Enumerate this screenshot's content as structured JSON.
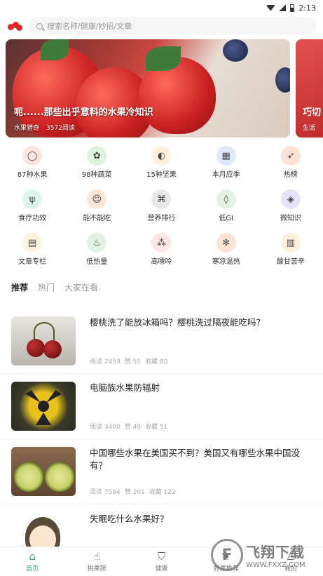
{
  "status": {
    "time": "2:13"
  },
  "search": {
    "placeholder": "搜索名称/健康/妙招/文章"
  },
  "banners": [
    {
      "title": "呃......那些出乎意料的水果冷知识",
      "tag": "水果猎奇",
      "reads": "3572阅读"
    },
    {
      "title": "巧切",
      "tag": "生活"
    }
  ],
  "categories": [
    {
      "label": "87种水果",
      "icon": "apple-icon",
      "color": "#fde5e2"
    },
    {
      "label": "98种蔬菜",
      "icon": "broccoli-icon",
      "color": "#dff2df"
    },
    {
      "label": "15种坚果",
      "icon": "nut-icon",
      "color": "#fdf1dc"
    },
    {
      "label": "本月应季",
      "icon": "calendar-icon",
      "color": "#dfe9fb"
    },
    {
      "label": "热榜",
      "icon": "rocket-icon",
      "color": "#fde2d6"
    },
    {
      "label": "食疗功效",
      "icon": "cutlery-icon",
      "color": "#dcf4ea"
    },
    {
      "label": "能不能吃",
      "icon": "question-face-icon",
      "color": "#fde5d4"
    },
    {
      "label": "营养排行",
      "icon": "molecule-icon",
      "color": "#e8e8e8"
    },
    {
      "label": "低GI",
      "icon": "drop-icon",
      "color": "#e2f3e3"
    },
    {
      "label": "微知识",
      "icon": "graduation-cap-icon",
      "color": "#e4e3f7"
    },
    {
      "label": "文章专栏",
      "icon": "article-icon",
      "color": "#fdf3dc"
    },
    {
      "label": "低热量",
      "icon": "flame-icon",
      "color": "#e1f1e2"
    },
    {
      "label": "高嘌呤",
      "icon": "atom-icon",
      "color": "#fde6e3"
    },
    {
      "label": "寒凉温热",
      "icon": "snowflake-icon",
      "color": "#fde3d3"
    },
    {
      "label": "酸甘苦辛",
      "icon": "book-icon",
      "color": "#fdf1dc"
    }
  ],
  "tabs": [
    {
      "label": "推荐",
      "active": true
    },
    {
      "label": "热门",
      "active": false
    },
    {
      "label": "大家在看",
      "active": false
    }
  ],
  "articles": [
    {
      "title": "樱桃洗了能放冰箱吗？樱桃洗过隔夜能吃吗？",
      "reads": "阅读 2459",
      "likes": "赞 55",
      "favs": "收藏 80"
    },
    {
      "title": "电脑族水果防辐射",
      "reads": "阅读 3400",
      "likes": "赞 49",
      "favs": "收藏 51"
    },
    {
      "title": "中国哪些水果在美国买不到？美国又有哪些水果中国没有？",
      "reads": "阅读 7594",
      "likes": "赞 201",
      "favs": "收藏 122"
    },
    {
      "title": "失眠吃什么水果好？",
      "reads": "",
      "likes": "",
      "favs": ""
    }
  ],
  "nav": [
    {
      "label": "首页",
      "icon": "home-icon",
      "active": true
    },
    {
      "label": "挑果蔬",
      "icon": "hand-icon",
      "active": false
    },
    {
      "label": "健康",
      "icon": "shield-icon",
      "active": false
    },
    {
      "label": "好果推荐",
      "icon": "fruit-icon",
      "active": false
    },
    {
      "label": "我的",
      "icon": "user-icon",
      "active": false
    }
  ],
  "watermark": {
    "big": "飞翔下载",
    "small": "WWW.FXXZ.COM",
    "letter": "F"
  },
  "colors": {
    "accent": "#3aa76d"
  }
}
